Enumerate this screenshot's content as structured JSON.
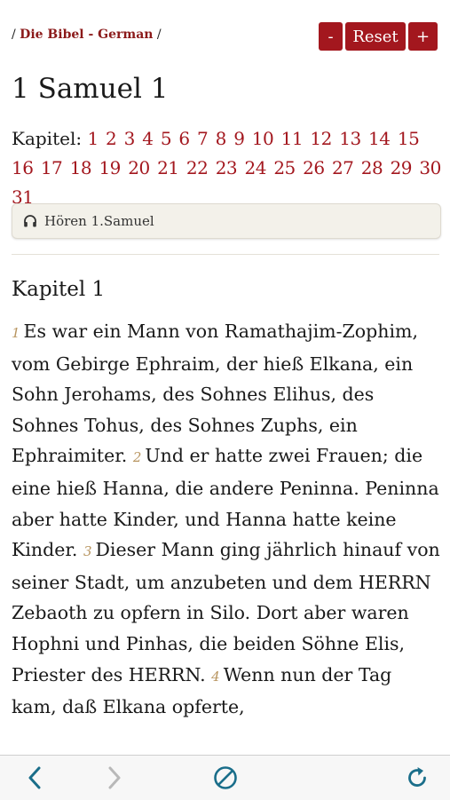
{
  "breadcrumb": {
    "prefix": "/",
    "link": "Die Bibel - German",
    "suffix": "/"
  },
  "zoom": {
    "minus_label": "-",
    "reset_label": "Reset",
    "plus_label": "+"
  },
  "page_title": "1 Samuel 1",
  "chapters": {
    "label": "Kapitel:",
    "items": [
      "1",
      "2",
      "3",
      "4",
      "5",
      "6",
      "7",
      "8",
      "9",
      "10",
      "11",
      "12",
      "13",
      "14",
      "15",
      "16",
      "17",
      "18",
      "19",
      "20",
      "21",
      "22",
      "23",
      "24",
      "25",
      "26",
      "27",
      "28",
      "29",
      "30",
      "31"
    ]
  },
  "listen": {
    "label": "Hören 1.Samuel",
    "icon": "headphones-icon"
  },
  "chapter_heading": "Kapitel 1",
  "verses": [
    {
      "num": "1",
      "text": "Es war ein Mann von Ramathajim-Zophim, vom Gebirge Ephraim, der hieß Elkana, ein Sohn Jerohams, des Sohnes Elihus, des Sohnes Tohus, des Sohnes Zuphs, ein Ephraimiter."
    },
    {
      "num": "2",
      "text": "Und er hatte zwei Frauen; die eine hieß Hanna, die andere Peninna. Peninna aber hatte Kinder, und Hanna hatte keine Kinder."
    },
    {
      "num": "3",
      "text": "Dieser Mann ging jährlich hinauf von seiner Stadt, um anzubeten und dem HERRN Zebaoth zu opfern in Silo. Dort aber waren Hophni und Pinhas, die beiden Söhne Elis, Priester des HERRN."
    },
    {
      "num": "4",
      "text": "Wenn nun der Tag kam, daß Elkana opferte,"
    }
  ],
  "toolbar": {
    "back": "chevron-left-icon",
    "forward": "chevron-right-icon",
    "stop": "stop-icon",
    "reload": "reload-icon"
  },
  "colors": {
    "accent": "#a3171e",
    "verse_number": "#b89560",
    "disabled": "#b8b8b8",
    "toolbar_icon": "#1a6e8a"
  }
}
